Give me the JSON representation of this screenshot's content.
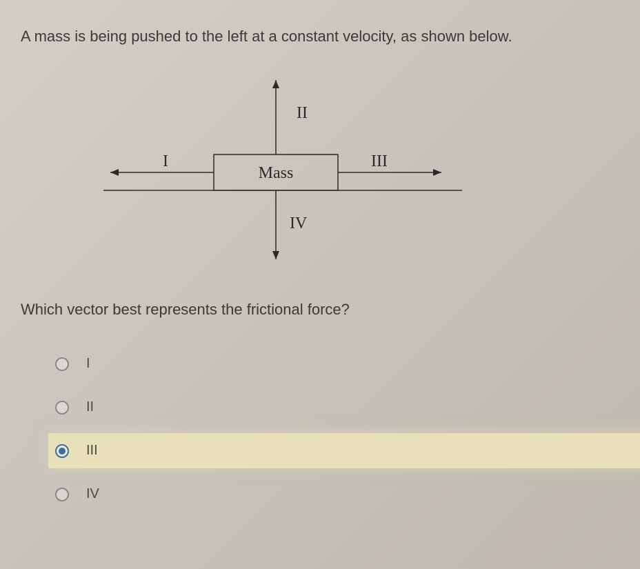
{
  "question": {
    "stem": "A mass is being pushed to the left at a constant velocity, as shown below.",
    "prompt": "Which vector best represents the frictional force?"
  },
  "diagram": {
    "center_label": "Mass",
    "vectors": {
      "left": "I",
      "up": "II",
      "right": "III",
      "down": "IV"
    }
  },
  "options": [
    {
      "label": "I",
      "selected": false
    },
    {
      "label": "II",
      "selected": false
    },
    {
      "label": "III",
      "selected": true
    },
    {
      "label": "IV",
      "selected": false
    }
  ]
}
